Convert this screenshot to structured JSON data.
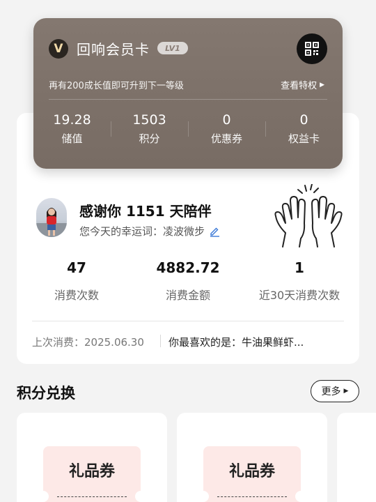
{
  "member_card": {
    "logo_letter": "V",
    "title": "回响会员卡",
    "level": "LV1",
    "upgrade_hint": "再有200成长值即可升到下一等级",
    "view_privileges": "查看特权",
    "qr_icon": "qr-code-icon",
    "assets": [
      {
        "value": "19.28",
        "label": "储值"
      },
      {
        "value": "1503",
        "label": "积分"
      },
      {
        "value": "0",
        "label": "优惠券"
      },
      {
        "value": "0",
        "label": "权益卡"
      }
    ]
  },
  "summary": {
    "greeting": "感谢你 1151 天陪伴",
    "fortune": "您今天的幸运词：凌波微步",
    "metrics": [
      {
        "value": "47",
        "label": "消费次数"
      },
      {
        "value": "4882.72",
        "label": "消费金额"
      },
      {
        "value": "1",
        "label": "近30天消费次数"
      }
    ],
    "last_visit": "上次消费：2025.06.30",
    "favorite": "你最喜欢的是：牛油果鲜虾..."
  },
  "exchange": {
    "title": "积分兑换",
    "more_label": "更多",
    "cards": [
      {
        "title": "礼品券"
      },
      {
        "title": "礼品券"
      }
    ]
  },
  "colors": {
    "card_brown": "#7e726a",
    "coupon_pink": "#fde9e7",
    "edit_blue": "#3a78d6"
  }
}
